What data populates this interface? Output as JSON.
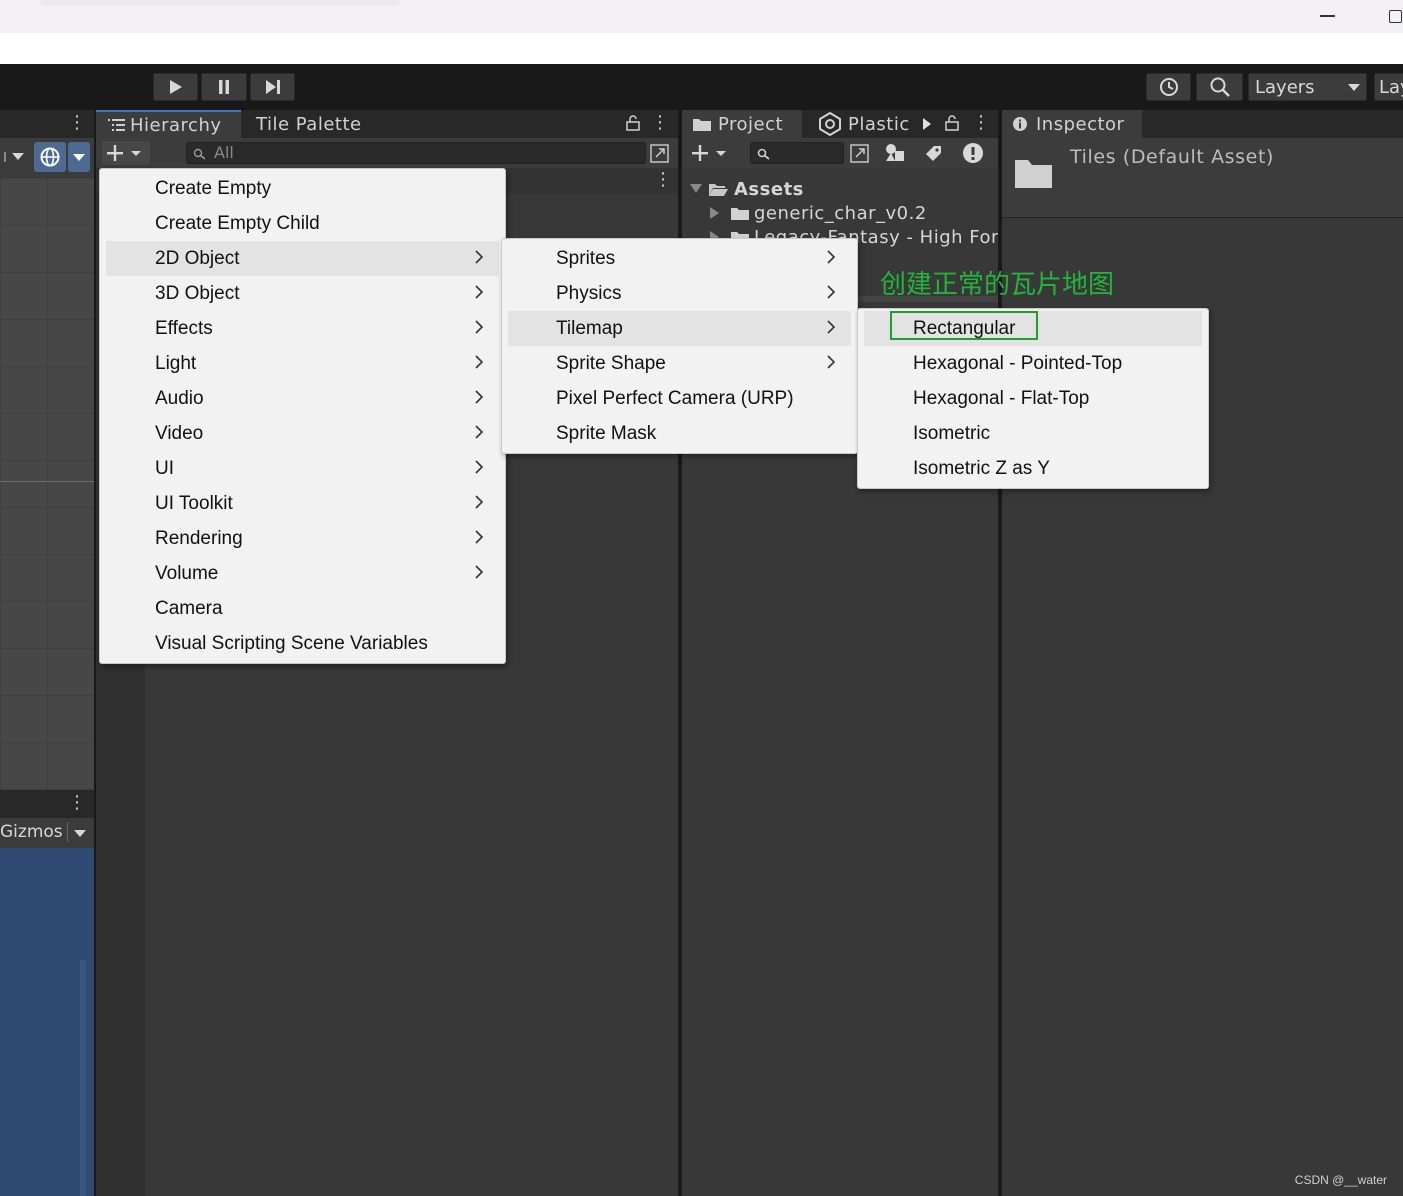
{
  "toolbar": {
    "layers_label": "Layers",
    "layout_label": "Lay"
  },
  "scene": {
    "gizmos_label": "Gizmos"
  },
  "hierarchy": {
    "tab_label": "Hierarchy",
    "tile_palette_label": "Tile Palette",
    "search_placeholder": "All"
  },
  "project": {
    "tab_label": "Project",
    "plastic_label": "Plastic S",
    "assets_label": "Assets",
    "items": [
      "generic_char_v0.2",
      "Legacy-Fantasy - High Fore"
    ]
  },
  "inspector": {
    "tab_label": "Inspector",
    "asset_title": "Tiles (Default Asset)"
  },
  "menu1": {
    "items": [
      {
        "label": "Create Empty",
        "submenu": false
      },
      {
        "label": "Create Empty Child",
        "submenu": false
      },
      {
        "label": "2D Object",
        "submenu": true
      },
      {
        "label": "3D Object",
        "submenu": true
      },
      {
        "label": "Effects",
        "submenu": true
      },
      {
        "label": "Light",
        "submenu": true
      },
      {
        "label": "Audio",
        "submenu": true
      },
      {
        "label": "Video",
        "submenu": true
      },
      {
        "label": "UI",
        "submenu": true
      },
      {
        "label": "UI Toolkit",
        "submenu": true
      },
      {
        "label": "Rendering",
        "submenu": true
      },
      {
        "label": "Volume",
        "submenu": true
      },
      {
        "label": "Camera",
        "submenu": false
      },
      {
        "label": "Visual Scripting Scene Variables",
        "submenu": false
      }
    ]
  },
  "menu2": {
    "items": [
      {
        "label": "Sprites",
        "submenu": true
      },
      {
        "label": "Physics",
        "submenu": true
      },
      {
        "label": "Tilemap",
        "submenu": true
      },
      {
        "label": "Sprite Shape",
        "submenu": true
      },
      {
        "label": "Pixel Perfect Camera (URP)",
        "submenu": false
      },
      {
        "label": "Sprite Mask",
        "submenu": false
      }
    ]
  },
  "menu3": {
    "items": [
      {
        "label": "Rectangular"
      },
      {
        "label": "Hexagonal - Pointed-Top"
      },
      {
        "label": "Hexagonal - Flat-Top"
      },
      {
        "label": "Isometric"
      },
      {
        "label": "Isometric Z as Y"
      }
    ]
  },
  "annotation": {
    "text": "创建正常的瓦片地图",
    "color": "#22b53a"
  },
  "watermark": "CSDN @__water",
  "colors": {
    "editor_bg": "#383838",
    "scene_blue": "#2f4a73",
    "menu_bg": "#f2f2f2",
    "highlight_box": "#1f9d2e"
  }
}
